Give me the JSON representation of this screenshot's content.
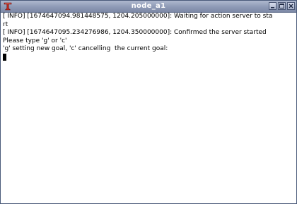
{
  "window": {
    "title": "node_a1"
  },
  "terminal": {
    "lines": [
      "[ INFO] [1674647094.981448575, 1204.205000000]: Waiting for action server to sta",
      "rt",
      "[ INFO] [1674647095.234276986, 1204.350000000]: Confirmed the server started",
      "Please type 'g' or 'c'",
      "'g' setting new goal, 'c' cancelling  the current goal:"
    ]
  },
  "icons": {
    "app": "terminal-app-icon",
    "minimize": "minimize-icon",
    "maximize": "maximize-icon",
    "close": "close-icon"
  },
  "colors": {
    "titlebar": "#8e9ab6",
    "title_text": "#ffffff",
    "app_icon": "#c0281e",
    "terminal_bg": "#ffffff",
    "terminal_fg": "#000000"
  }
}
